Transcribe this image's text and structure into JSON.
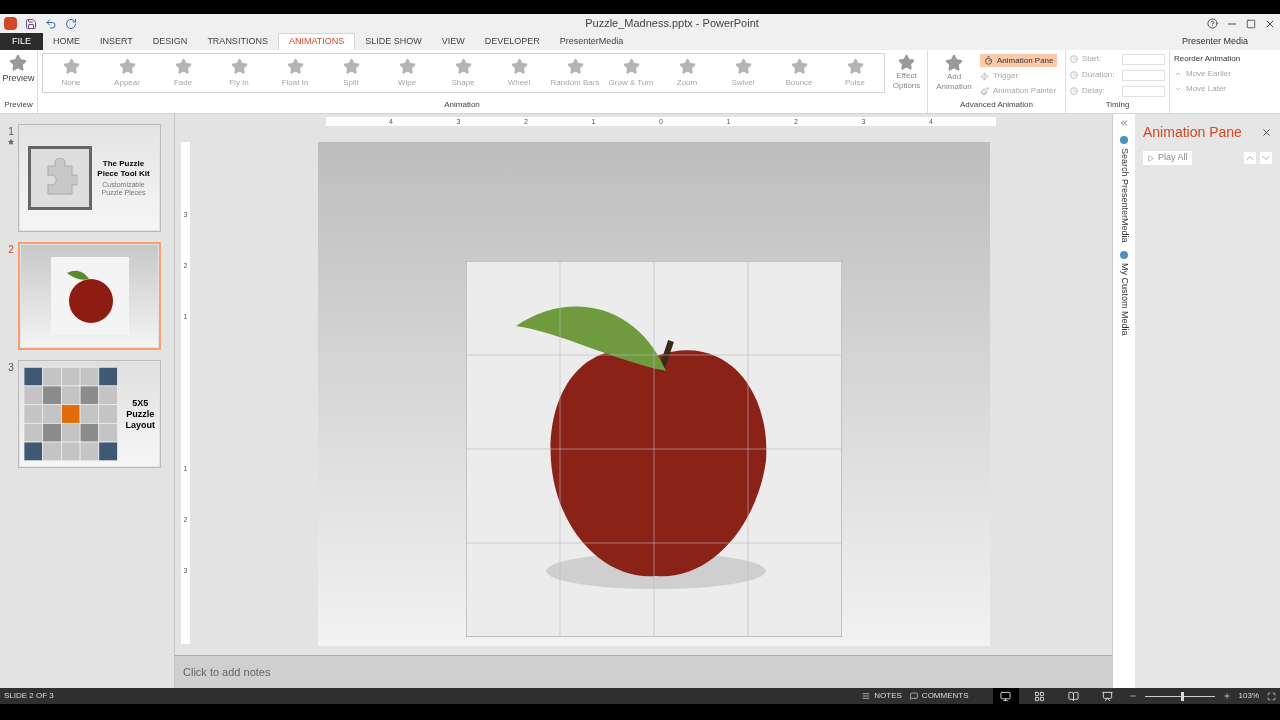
{
  "window": {
    "title": "Puzzle_Madness.pptx - PowerPoint",
    "account": "Presenter Media"
  },
  "tabs": [
    {
      "label": "FILE",
      "kind": "file",
      "selected": false
    },
    {
      "label": "HOME",
      "kind": "tab",
      "selected": false
    },
    {
      "label": "INSERT",
      "kind": "tab",
      "selected": false
    },
    {
      "label": "DESIGN",
      "kind": "tab",
      "selected": false
    },
    {
      "label": "TRANSITIONS",
      "kind": "tab",
      "selected": false
    },
    {
      "label": "ANIMATIONS",
      "kind": "tab",
      "selected": true
    },
    {
      "label": "SLIDE SHOW",
      "kind": "tab",
      "selected": false
    },
    {
      "label": "VIEW",
      "kind": "tab",
      "selected": false
    },
    {
      "label": "DEVELOPER",
      "kind": "tab",
      "selected": false
    },
    {
      "label": "PresenterMedia",
      "kind": "tab",
      "selected": false
    }
  ],
  "ribbon": {
    "preview": {
      "label": "Preview",
      "group": "Preview"
    },
    "animations": [
      {
        "label": "None",
        "disabled": true
      },
      {
        "label": "Appear",
        "disabled": true
      },
      {
        "label": "Fade",
        "disabled": true
      },
      {
        "label": "Fly In",
        "disabled": true
      },
      {
        "label": "Float In",
        "disabled": true
      },
      {
        "label": "Split",
        "disabled": true
      },
      {
        "label": "Wipe",
        "disabled": true
      },
      {
        "label": "Shape",
        "disabled": true
      },
      {
        "label": "Wheel",
        "disabled": true
      },
      {
        "label": "Random Bars",
        "disabled": true
      },
      {
        "label": "Grow & Turn",
        "disabled": true
      },
      {
        "label": "Zoom",
        "disabled": true
      },
      {
        "label": "Swivel",
        "disabled": true
      },
      {
        "label": "Bounce",
        "disabled": true
      },
      {
        "label": "Pulse",
        "disabled": true
      }
    ],
    "animation_group": "Animation",
    "effect_options": {
      "label": "Effect Options",
      "disabled": true
    },
    "advanced": {
      "add_animation": "Add Animation",
      "animation_pane": {
        "label": "Animation Pane",
        "selected": true
      },
      "trigger": "Trigger",
      "painter": "Animation Painter",
      "group": "Advanced Animation"
    },
    "timing": {
      "start": "Start:",
      "duration": "Duration:",
      "delay": "Delay:",
      "reorder": "Reorder Animation",
      "move_earlier": "Move Earlier",
      "move_later": "Move Later",
      "group": "Timing"
    }
  },
  "slides": [
    {
      "number": "1",
      "animated": true,
      "selected": false,
      "kind": "title",
      "title": "The Puzzle Piece Tool Kit",
      "subtitle": "Customizable Puzzle Pieces"
    },
    {
      "number": "2",
      "animated": false,
      "selected": true,
      "kind": "apple"
    },
    {
      "number": "3",
      "animated": false,
      "selected": false,
      "kind": "grid",
      "title": "5X5 Puzzle Layout"
    }
  ],
  "rulers": {
    "horizontal": [
      "4",
      "3",
      "2",
      "1",
      "0",
      "1",
      "2",
      "3",
      "4"
    ],
    "vertical": [
      "3",
      "2",
      "1",
      "1",
      "2",
      "3"
    ]
  },
  "notes": {
    "placeholder": "Click to add notes"
  },
  "side_tabs": [
    "Search PresenterMedia",
    "My Custom Media"
  ],
  "animation_pane": {
    "title": "Animation Pane",
    "play_all": "Play All"
  },
  "status_bar": {
    "slide": "SLIDE 2 OF 3",
    "notes": "NOTES",
    "comments": "COMMENTS",
    "views": [
      {
        "kind": "normal",
        "selected": true
      },
      {
        "kind": "sorter",
        "selected": false
      },
      {
        "kind": "reading",
        "selected": false
      },
      {
        "kind": "show",
        "selected": false
      }
    ],
    "zoom": {
      "level": 0.52,
      "reading": "103%"
    }
  }
}
